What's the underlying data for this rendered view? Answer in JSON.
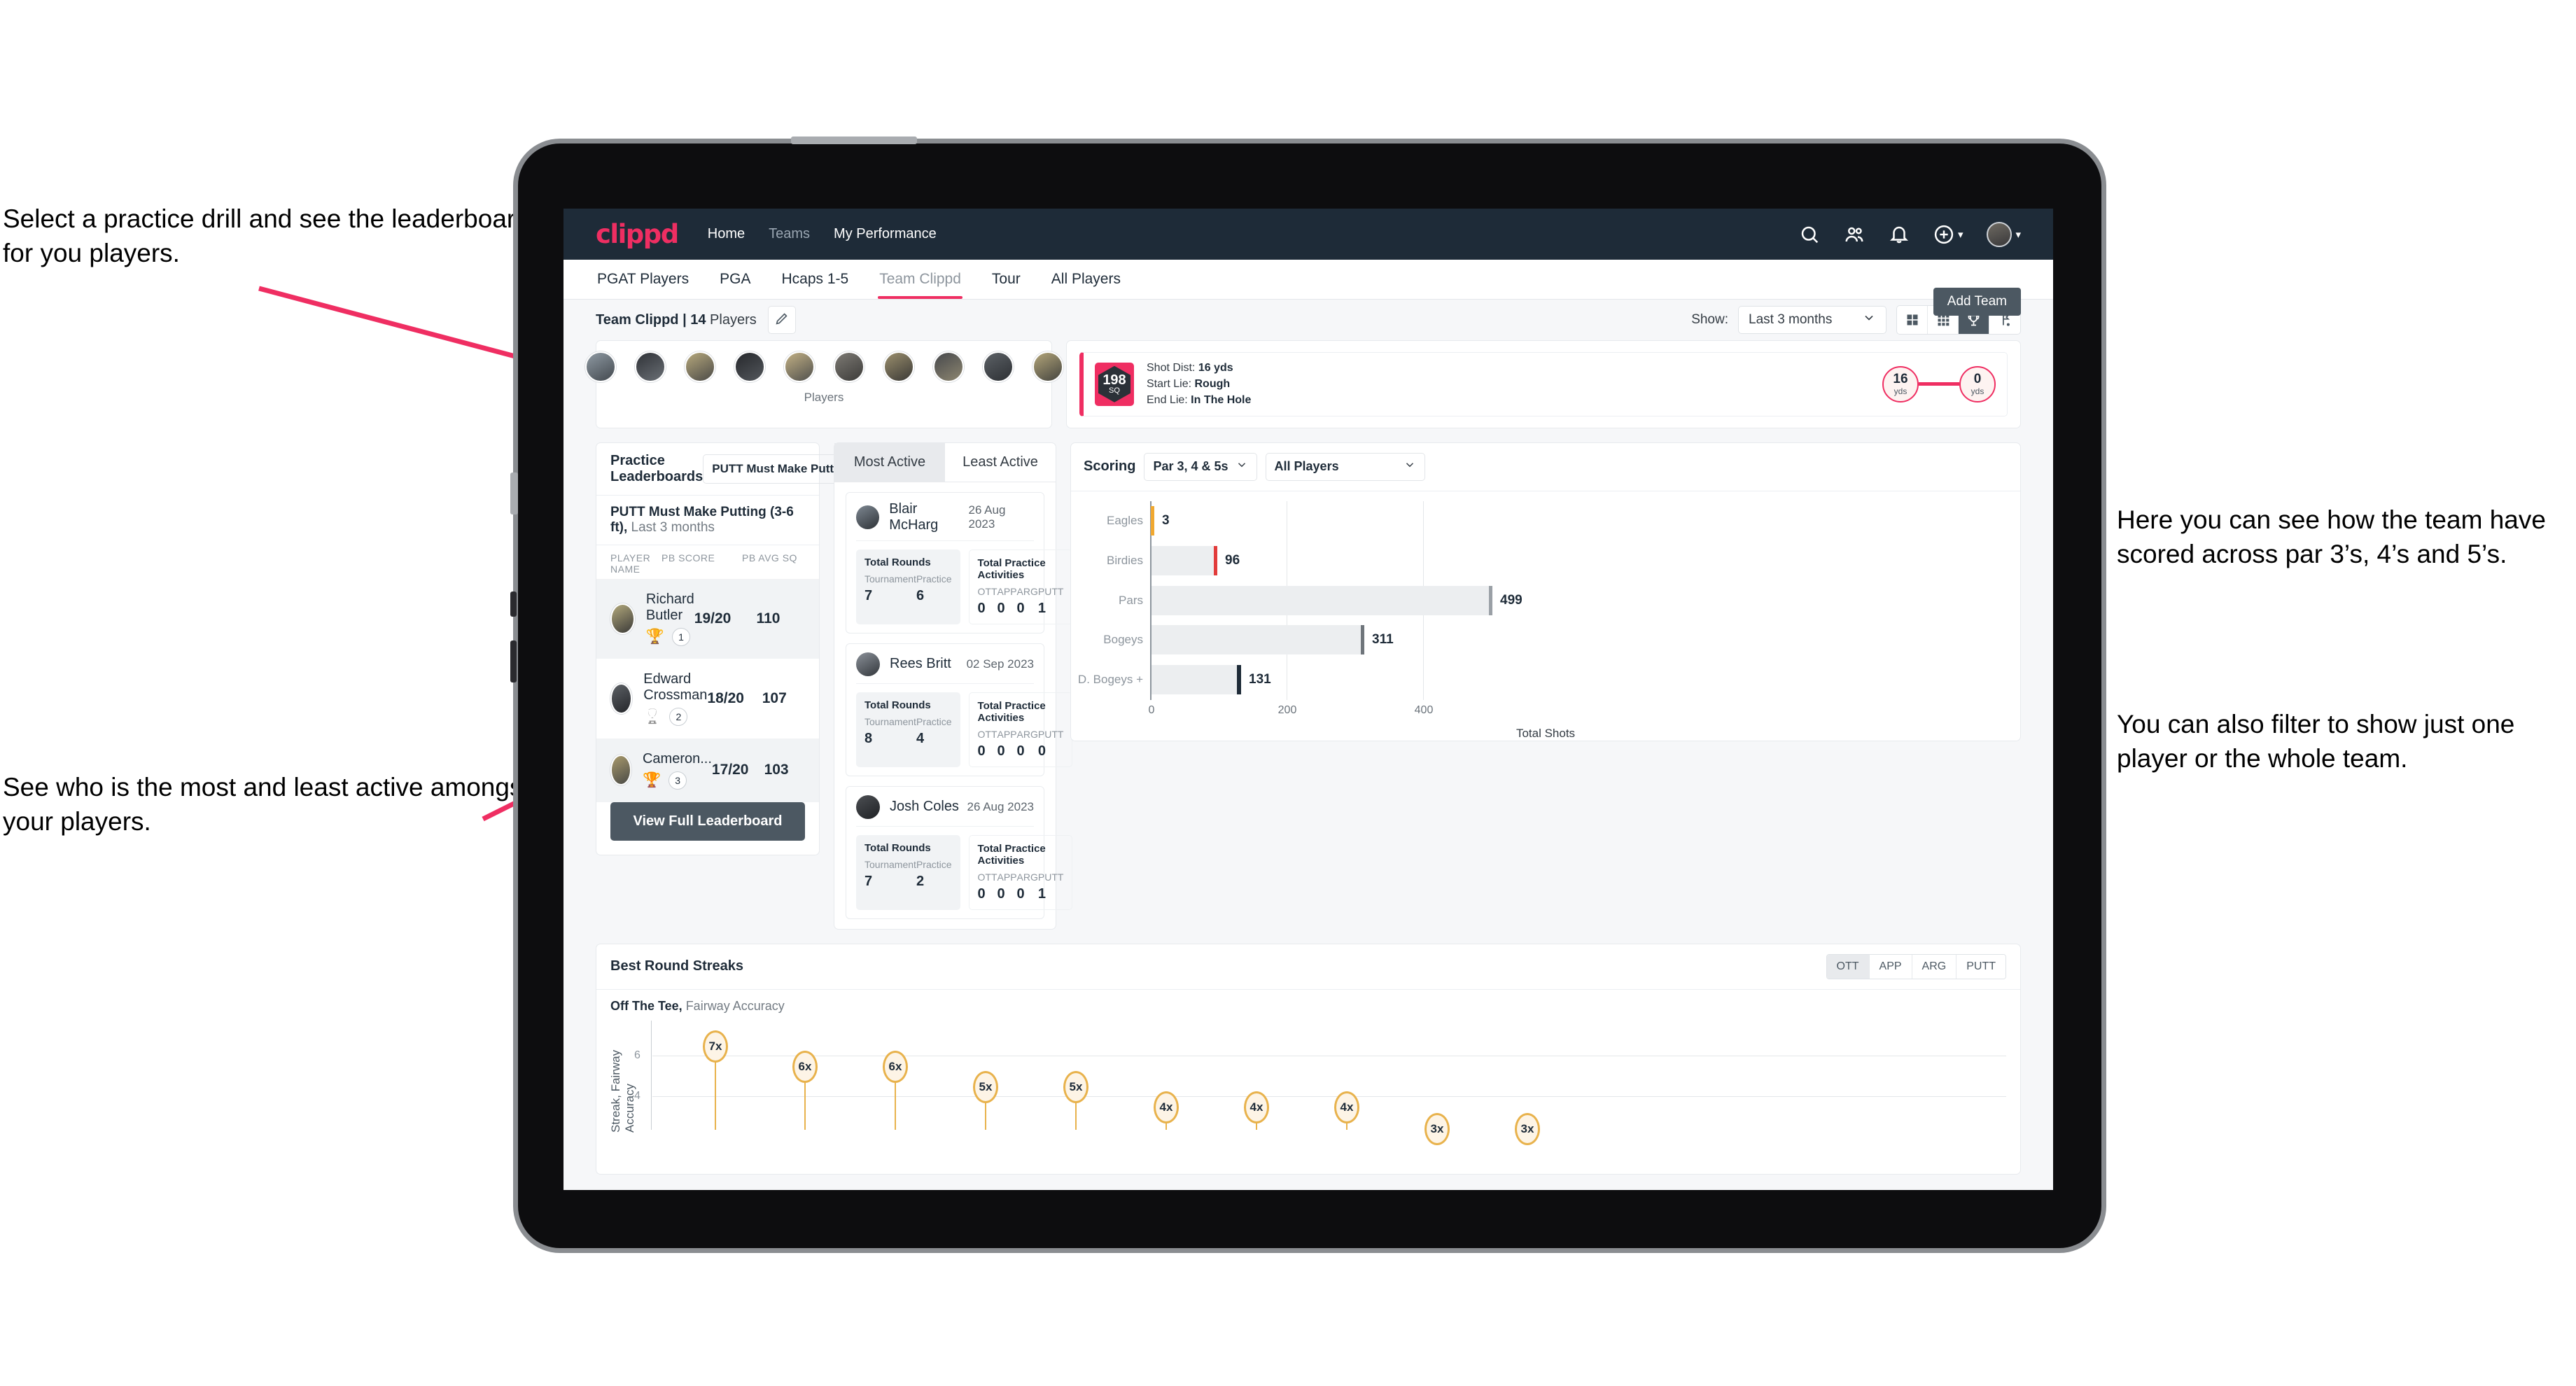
{
  "annotations": {
    "left_top": "Select a practice drill and see the leaderboard for you players.",
    "left_bottom": "See who is the most and least active amongst your players.",
    "right_top": "Here you can see how the team have scored across par 3’s, 4’s and 5’s.",
    "right_bottom": "You can also filter to show just one player or the whole team."
  },
  "app": {
    "logo": "clippd",
    "nav": [
      {
        "label": "Home",
        "active": true
      },
      {
        "label": "Teams",
        "active": false
      },
      {
        "label": "My Performance",
        "active": true
      }
    ],
    "header_icons": [
      "search-icon",
      "people-icon",
      "bell-icon",
      "plus-circle-icon",
      "avatar"
    ]
  },
  "tabs": [
    {
      "label": "PGAT Players",
      "active": false
    },
    {
      "label": "PGA",
      "active": false
    },
    {
      "label": "Hcaps 1-5",
      "active": false
    },
    {
      "label": "Team Clippd",
      "active": true
    },
    {
      "label": "Tour",
      "active": false
    },
    {
      "label": "All Players",
      "active": false
    }
  ],
  "add_team_button": "Add Team",
  "subbar": {
    "team_label_bold": "Team Clippd | 14",
    "team_label_rest": " Players",
    "edit_icon": "pencil-icon",
    "show_label": "Show:",
    "show_value": "Last 3 months",
    "view_modes": [
      "grid-large-icon",
      "grid-small-icon",
      "trophy-icon",
      "flag-icon"
    ],
    "view_mode_active_index": 2
  },
  "players_strip": {
    "caption": "Players",
    "avatar_count": 10
  },
  "shot_card": {
    "sq_value": "198",
    "sq_unit": "SQ",
    "lines": [
      {
        "key": "Shot Dist:",
        "value": "16 yds"
      },
      {
        "key": "Start Lie:",
        "value": "Rough"
      },
      {
        "key": "End Lie:",
        "value": "In The Hole"
      }
    ],
    "start_dist": "16",
    "start_unit": "yds",
    "end_dist": "0",
    "end_unit": "yds"
  },
  "leaderboard": {
    "title": "Practice Leaderboards",
    "drill_select": "PUTT Must Make Putting ...",
    "subtitle_bold": "PUTT Must Make Putting (3-6 ft),",
    "subtitle_rest": " Last 3 months",
    "columns": [
      "PLAYER NAME",
      "PB SCORE",
      "PB AVG SQ"
    ],
    "rows": [
      {
        "name": "Richard Butler",
        "trophy": "gold",
        "rank": "1",
        "pb_score": "19/20",
        "pb_avg_sq": "110"
      },
      {
        "name": "Edward Crossman",
        "trophy": "silver",
        "rank": "2",
        "pb_score": "18/20",
        "pb_avg_sq": "107"
      },
      {
        "name": "Cameron...",
        "trophy": "bronze",
        "rank": "3",
        "pb_score": "17/20",
        "pb_avg_sq": "103"
      }
    ],
    "button": "View Full Leaderboard"
  },
  "activity": {
    "tabs": [
      {
        "label": "Most Active",
        "active": true
      },
      {
        "label": "Least Active",
        "active": false
      }
    ],
    "rounds_title": "Total Rounds",
    "practice_title": "Total Practice Activities",
    "rounds_keys": [
      "Tournament",
      "Practice"
    ],
    "practice_keys": [
      "OTT",
      "APP",
      "ARG",
      "PUTT"
    ],
    "cards": [
      {
        "name": "Blair McHarg",
        "date": "26 Aug 2023",
        "tournament": "7",
        "practice": "6",
        "ott": "0",
        "app": "0",
        "arg": "0",
        "putt": "1"
      },
      {
        "name": "Rees Britt",
        "date": "02 Sep 2023",
        "tournament": "8",
        "practice": "4",
        "ott": "0",
        "app": "0",
        "arg": "0",
        "putt": "0"
      },
      {
        "name": "Josh Coles",
        "date": "26 Aug 2023",
        "tournament": "7",
        "practice": "2",
        "ott": "0",
        "app": "0",
        "arg": "0",
        "putt": "1"
      }
    ]
  },
  "scoring": {
    "title": "Scoring",
    "par_select": "Par 3, 4 & 5s",
    "player_select": "All Players"
  },
  "streaks": {
    "title": "Best Round Streaks",
    "segments": [
      {
        "label": "OTT",
        "active": true
      },
      {
        "label": "APP",
        "active": false
      },
      {
        "label": "ARG",
        "active": false
      },
      {
        "label": "PUTT",
        "active": false
      }
    ],
    "sub_bold": "Off The Tee,",
    "sub_rest": " Fairway Accuracy"
  },
  "colors": {
    "brand_pink": "#ef2e62",
    "navy": "#1e2b38",
    "slate": "#4c5862",
    "amber": "#e8b24c",
    "grey_bar": "#eceef0"
  },
  "chart_data": [
    {
      "type": "bar",
      "orientation": "horizontal",
      "title": "Scoring",
      "categories": [
        "Eagles",
        "Birdies",
        "Pars",
        "Bogeys",
        "D. Bogeys +"
      ],
      "values": [
        3,
        96,
        499,
        311,
        131
      ],
      "cap_colors": [
        "#f0a830",
        "#e23b3b",
        "#9aa0a6",
        "#6f757b",
        "#1e2b38"
      ],
      "xlabel": "Total Shots",
      "ylabel": "",
      "xlim": [
        0,
        540
      ],
      "xticks": [
        0,
        200,
        400
      ],
      "grid": true,
      "legend": "none"
    },
    {
      "type": "scatter",
      "title": "Best Round Streaks",
      "subtitle": "Off The Tee, Fairway Accuracy",
      "ylabel": "Streak, Fairway Accuracy",
      "xlabel": "",
      "yticks": [
        4,
        6
      ],
      "ylim": [
        2.2,
        7.8
      ],
      "values": [
        7,
        6,
        6,
        5,
        5,
        4,
        4,
        4,
        3,
        3
      ],
      "point_labels": [
        "7x",
        "6x",
        "6x",
        "5x",
        "5x",
        "4x",
        "4x",
        "4x",
        "3x",
        "3x"
      ],
      "grid": true,
      "legend": "none"
    }
  ]
}
